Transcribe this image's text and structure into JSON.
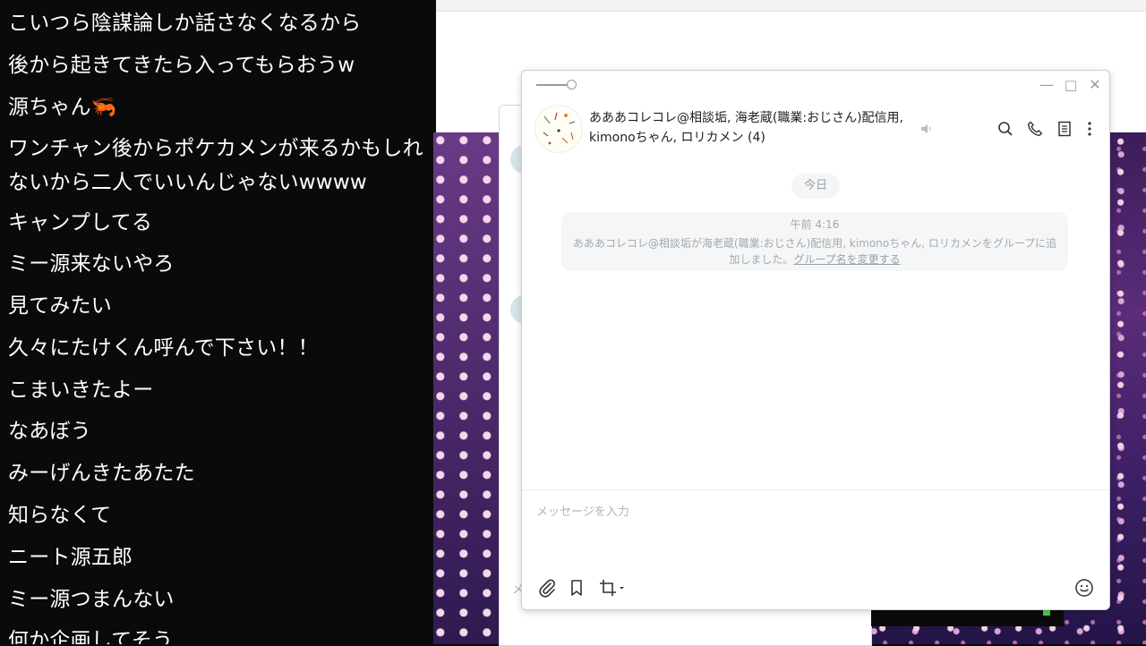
{
  "comments": [
    "こいつら陰謀論しか話さなくなるから",
    "後から起きてきたら入ってもらおうw",
    "源ちゃん🦐",
    "ワンチャン後からポケカメンが来るかもしれないから二人でいいんじゃないwwww",
    "キャンプしてる",
    "ミー源来ないやろ",
    "見てみたい",
    "久々にたけくん呼んで下さい！！",
    "こまいきたよー",
    "なあぼう",
    "みーげんきたあたた",
    "知らなくて",
    "ニート源五郎",
    "ミー源つまんない",
    "何か企画してそう"
  ],
  "chat": {
    "title": "あああコレコレ@相談垢, 海老蔵(職業:おじさん)配信用, kimonoちゃん, ロリカメン (4)",
    "date_label": "今日",
    "system_time": "午前 4:16",
    "system_message": "あああコレコレ@相談垢が海老蔵(職業:おじさん)配信用, kimonoちゃん, ロリカメンをグループに追加しました。",
    "system_link": "グループ名を変更する",
    "input_placeholder": "メッセージを入力",
    "window_controls": {
      "minimize": "—",
      "maximize": "□",
      "close": "✕"
    },
    "header_icons": [
      "mute-speaker-icon",
      "search-icon",
      "phone-icon",
      "notes-icon",
      "more-icon"
    ],
    "toolbar_icons": [
      "attach-icon",
      "bookmark-icon",
      "crop-icon",
      "emoji-icon"
    ]
  },
  "back_window": {
    "input_hint": "メ"
  },
  "colors": {
    "comment_text": "#ffffff",
    "comment_bg": "#0a0a0a",
    "system_text": "#a4a9ad",
    "sakura_bg": "#3b1d5a"
  }
}
